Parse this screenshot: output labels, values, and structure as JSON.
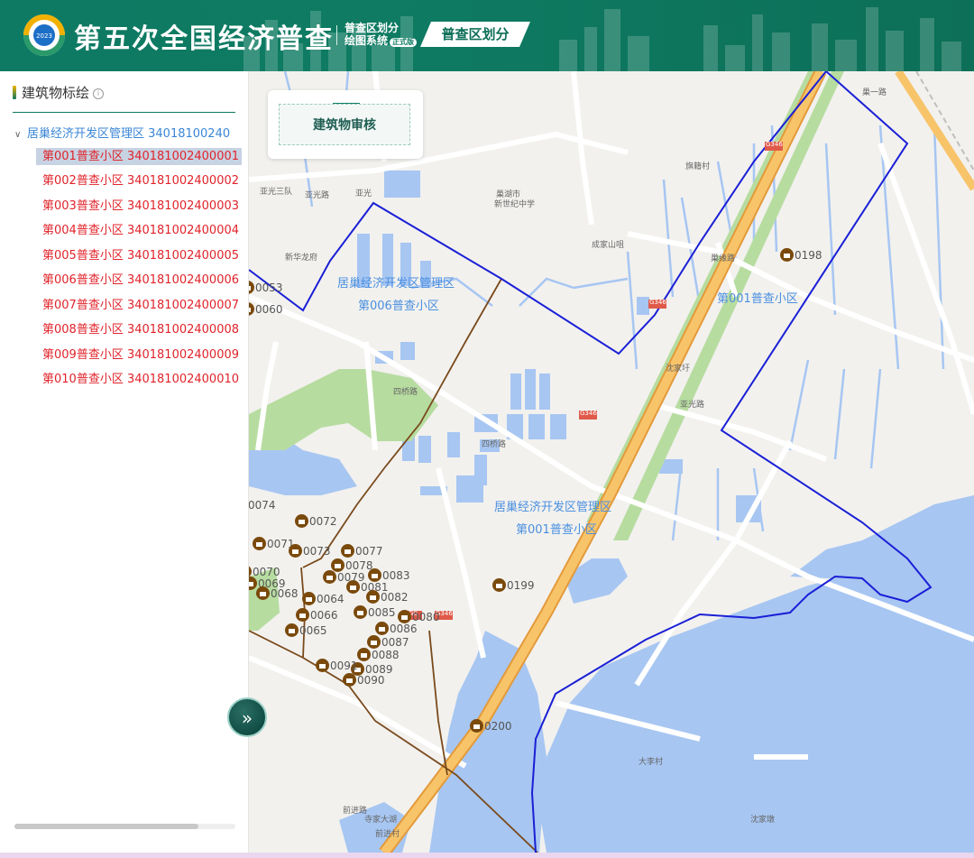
{
  "header": {
    "logo_year": "2023",
    "title": "第五次全国经济普查",
    "subtitle_line1": "普查区划分",
    "subtitle_line2": "绘图系统",
    "badge": "正式版",
    "module_tab": "普查区划分"
  },
  "sidebar": {
    "panel_title": "建筑物标绘",
    "tree": {
      "root_label": "居巢经济开发区管理区 34018100240",
      "items": [
        {
          "label": "第001普查小区 340181002400001",
          "selected": true
        },
        {
          "label": "第002普查小区 340181002400002"
        },
        {
          "label": "第003普查小区 340181002400003"
        },
        {
          "label": "第004普查小区 340181002400004"
        },
        {
          "label": "第005普查小区 340181002400005"
        },
        {
          "label": "第006普查小区 340181002400006"
        },
        {
          "label": "第007普查小区 340181002400007"
        },
        {
          "label": "第008普查小区 340181002400008"
        },
        {
          "label": "第009普查小区 340181002400009"
        },
        {
          "label": "第010普查小区 340181002400010"
        }
      ]
    },
    "collapse_glyph": "»"
  },
  "map": {
    "review_button": "建筑物审核",
    "region_labels": [
      "居巢经济开发区管理区",
      "第006普查小区",
      "第001普查小区",
      "居巢经济开发区管理区",
      "第001普查小区"
    ],
    "place_labels": [
      "亚光三队",
      "亚光路",
      "亚光",
      "巢湖市",
      "新世纪中学",
      "旗籍村",
      "成家山咀",
      "新华龙府",
      "沈家圩",
      "四桥路",
      "四桥路",
      "亚光路",
      "大李村",
      "沈家墩",
      "前进路",
      "寺家大湖",
      "前进村",
      "巢一路",
      "巢缘路",
      "G346",
      "G346",
      "G346",
      "G346",
      "G0"
    ],
    "markers": [
      "0198",
      "0053",
      "0060",
      "0072",
      "0071",
      "0073",
      "0077",
      "0078",
      "0083",
      "0081",
      "0082",
      "0079",
      "0069",
      "0068",
      "0070",
      "0066",
      "0085",
      "0080",
      "0086",
      "0087",
      "0088",
      "0089",
      "0090",
      "0199",
      "0200",
      "0074",
      "0064",
      "0065",
      "0091"
    ],
    "colors": {
      "boundary_blue": "#1a1fd6",
      "boundary_brown": "#7a4a1c",
      "expressway": "#f3b35a",
      "water": "#a7c6f2",
      "green": "#b7dca0",
      "marker": "#7a4a0c"
    }
  }
}
